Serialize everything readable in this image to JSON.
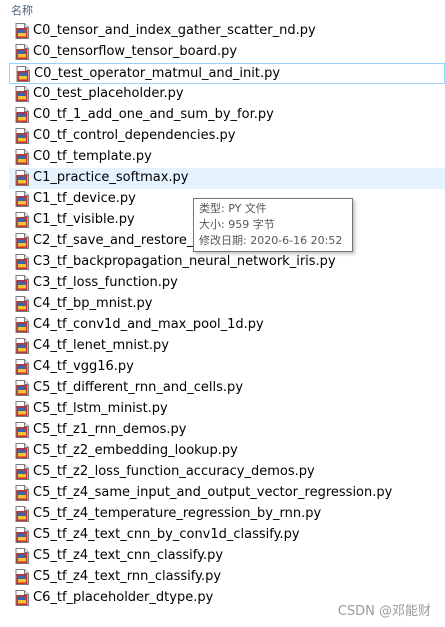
{
  "header": {
    "column_name": "名称"
  },
  "icon": {
    "name": "python-file-icon",
    "colors": {
      "accent_red": "#c62f2f",
      "accent_yellow": "#f2c230",
      "focus_border": "#99d1ff",
      "hover_bg": "#e5f3ff"
    }
  },
  "files": [
    {
      "name": "C0_tensor_and_index_gather_scatter_nd.py"
    },
    {
      "name": "C0_tensorflow_tensor_board.py"
    },
    {
      "name": "C0_test_operator_matmul_and_init.py"
    },
    {
      "name": "C0_test_placeholder.py"
    },
    {
      "name": "C0_tf_1_add_one_and_sum_by_for.py"
    },
    {
      "name": "C0_tf_control_dependencies.py"
    },
    {
      "name": "C0_tf_template.py"
    },
    {
      "name": "C1_practice_softmax.py"
    },
    {
      "name": "C1_tf_device.py"
    },
    {
      "name": "C1_tf_visible.py"
    },
    {
      "name": "C2_tf_save_and_restore_mo"
    },
    {
      "name": "C3_tf_backpropagation_neural_network_iris.py"
    },
    {
      "name": "C3_tf_loss_function.py"
    },
    {
      "name": "C4_tf_bp_mnist.py"
    },
    {
      "name": "C4_tf_conv1d_and_max_pool_1d.py"
    },
    {
      "name": "C4_tf_lenet_mnist.py"
    },
    {
      "name": "C4_tf_vgg16.py"
    },
    {
      "name": "C5_tf_different_rnn_and_cells.py"
    },
    {
      "name": "C5_tf_lstm_minist.py"
    },
    {
      "name": "C5_tf_z1_rnn_demos.py"
    },
    {
      "name": "C5_tf_z2_embedding_lookup.py"
    },
    {
      "name": "C5_tf_z2_loss_function_accuracy_demos.py"
    },
    {
      "name": "C5_tf_z4_same_input_and_output_vector_regression.py"
    },
    {
      "name": "C5_tf_z4_temperature_regression_by_rnn.py"
    },
    {
      "name": "C5_tf_z4_text_cnn_by_conv1d_classify.py"
    },
    {
      "name": "C5_tf_z4_text_cnn_classify.py"
    },
    {
      "name": "C5_tf_z4_text_rnn_classify.py"
    },
    {
      "name": "C6_tf_placeholder_dtype.py"
    }
  ],
  "focused_index": 2,
  "hovered_index": 7,
  "tooltip": {
    "type_line": "类型: PY 文件",
    "size_line": "大小: 959 字节",
    "modified_line": "修改日期: 2020-6-16 20:52"
  },
  "watermark": {
    "text": "CSDN @邓能财"
  }
}
